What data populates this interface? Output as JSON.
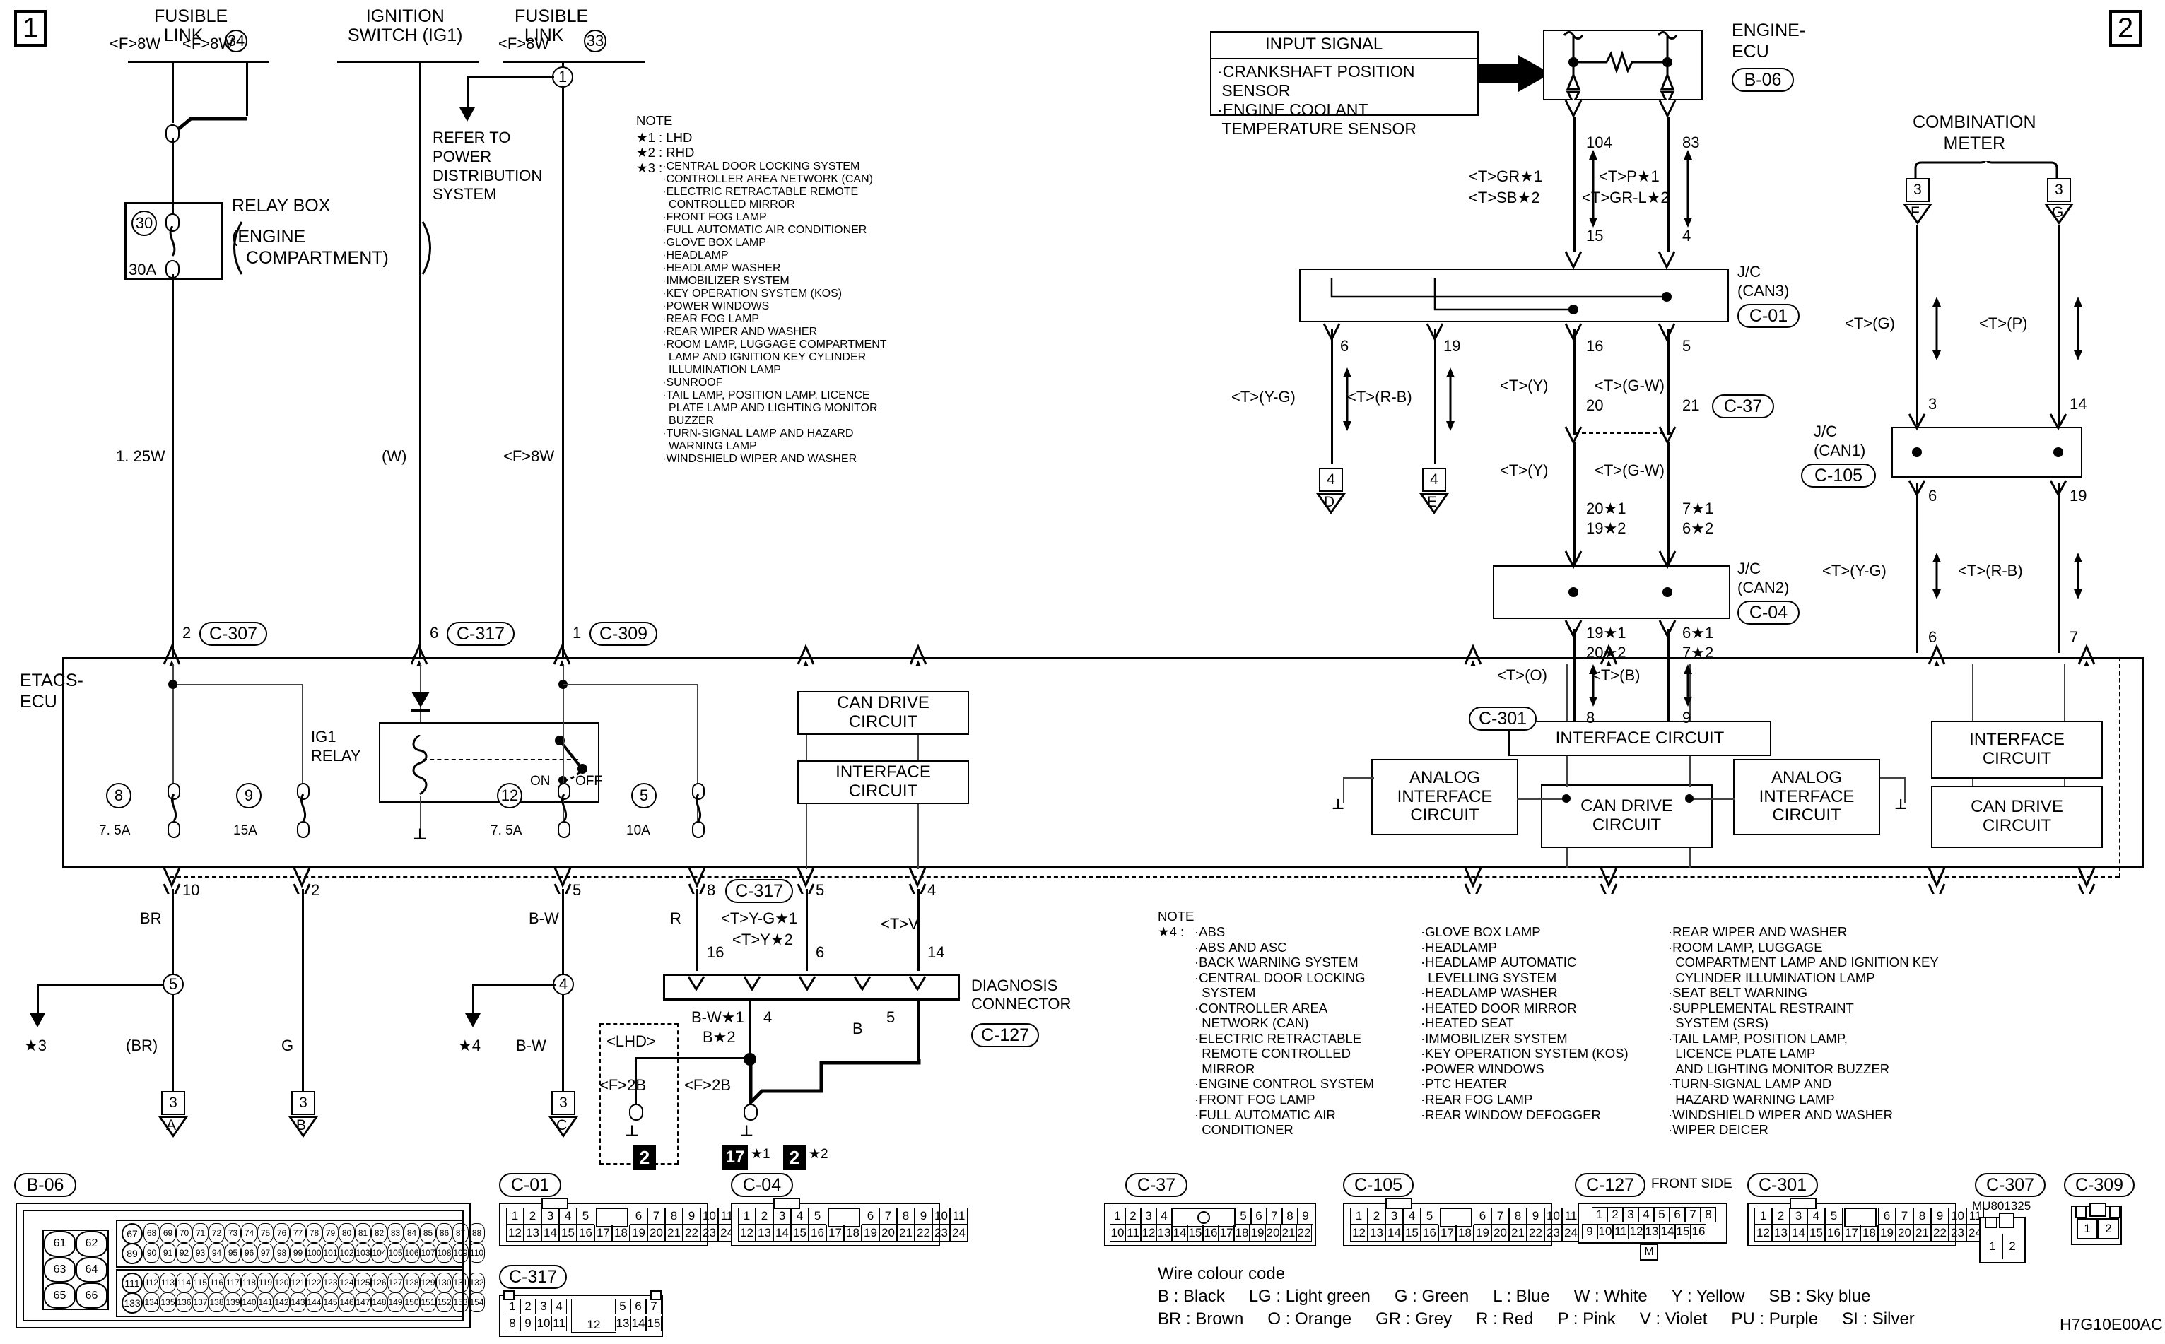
{
  "page": {
    "left_page_number": "1",
    "right_page_number": "2",
    "drawing_code": "H7G10E00AC"
  },
  "top_sources": [
    {
      "name": "FUSIBLE\nLINK",
      "circle": "34"
    },
    {
      "name": "IGNITION\nSWITCH (IG1)",
      "circle": ""
    },
    {
      "name": "FUSIBLE\nLINK",
      "circle": "33"
    }
  ],
  "top_wire_labels": [
    "<F>8W",
    "<F>8W",
    "<F>8W"
  ],
  "relay_box": {
    "label": "RELAY BOX",
    "sub": "(ENGINE\nCOMPARTMENT)",
    "fuse_circle": "30",
    "fuse_rating": "30A"
  },
  "refer_text": "REFER TO\nPOWER\nDISTRIBUTION\nSYSTEM",
  "ign_branch_circle": "1",
  "mid_wire_labels": [
    "1. 25W",
    "(W)",
    "<F>8W"
  ],
  "note1": {
    "title": "NOTE",
    "lines": [
      "★1 : LHD",
      "★2 : RHD"
    ],
    "star3_label": "★3 :",
    "star3_items": [
      "·CENTRAL DOOR LOCKING SYSTEM",
      "·CONTROLLER AREA NETWORK (CAN)",
      "·ELECTRIC RETRACTABLE REMOTE",
      "  CONTROLLED MIRROR",
      "·FRONT FOG LAMP",
      "·FULL AUTOMATIC AIR CONDITIONER",
      "·GLOVE BOX LAMP",
      "·HEADLAMP",
      "·HEADLAMP WASHER",
      "·IMMOBILIZER SYSTEM",
      "·KEY OPERATION SYSTEM (KOS)",
      "·POWER WINDOWS",
      "·REAR FOG LAMP",
      "·REAR WIPER AND WASHER",
      "·ROOM LAMP, LUGGAGE COMPARTMENT",
      "  LAMP AND IGNITION KEY CYLINDER",
      "  ILLUMINATION LAMP",
      "·SUNROOF",
      "·TAIL LAMP, POSITION LAMP, LICENCE",
      "  PLATE LAMP AND LIGHTING MONITOR",
      "  BUZZER",
      "·TURN-SIGNAL LAMP AND HAZARD",
      "  WARNING LAMP",
      "·WINDSHIELD WIPER AND WASHER"
    ]
  },
  "etacs": {
    "label": "ETACS-\nECU",
    "ig1_relay_label": "IG1\nRELAY",
    "relay_on": "ON",
    "relay_off": "OFF",
    "fuses": [
      {
        "circle": "8",
        "rating": "7. 5A"
      },
      {
        "circle": "9",
        "rating": "15A"
      },
      {
        "circle": "12",
        "rating": "7. 5A"
      },
      {
        "circle": "5",
        "rating": "10A"
      }
    ],
    "blocks_left": [
      "CAN DRIVE\nCIRCUIT",
      "INTERFACE\nCIRCUIT"
    ],
    "blocks_right": [
      "INTERFACE CIRCUIT",
      "ANALOG\nINTERFACE\nCIRCUIT",
      "CAN DRIVE\nCIRCUIT",
      "ANALOG\nINTERFACE\nCIRCUIT",
      "INTERFACE\nCIRCUIT",
      "CAN DRIVE\nCIRCUIT"
    ]
  },
  "top_connectors": [
    {
      "pin": "2",
      "id": "C-307"
    },
    {
      "pin": "6",
      "id": "C-317"
    },
    {
      "pin": "1",
      "id": "C-309"
    }
  ],
  "bottom_pins_left": [
    "10",
    "2",
    "5",
    "8",
    "5",
    "4"
  ],
  "bottom_wire_colors": [
    "BR",
    "",
    "B-W",
    "R",
    "",
    ""
  ],
  "lower_left": {
    "branch5": "5",
    "star3": "★3",
    "br_paren": "(BR)",
    "g_wire": "G",
    "branch4": "4",
    "star4": "★4",
    "bw_wire": "B-W",
    "grounds": [
      {
        "num": "3",
        "letter": "A"
      },
      {
        "num": "3",
        "letter": "B"
      },
      {
        "num": "3",
        "letter": "C"
      }
    ]
  },
  "diagnosis": {
    "title": "DIAGNOSIS\nCONNECTOR",
    "id": "C-127",
    "c317_pin": "8",
    "c317_id": "C-317",
    "wire_yg": "<T>Y-G★1",
    "wire_y": "<T>Y★2",
    "wire_v": "<T>V",
    "top_pins": [
      "5",
      "4"
    ],
    "conn_pins": [
      "16",
      "6",
      "14"
    ],
    "pin4": "4",
    "pin5": "5",
    "gnd_wire1": "B-W★1",
    "gnd_wire2": "B★2",
    "gnd_wire_b": "B",
    "lhd": "<LHD>",
    "f2b_left": "<F>2B",
    "f2b_right": "<F>2B",
    "gnd_boxes": [
      "2",
      "17",
      "2"
    ],
    "gnd_stars": [
      "",
      "★1",
      "★2"
    ]
  },
  "input_signal": {
    "title": "INPUT SIGNAL",
    "items": [
      "·CRANKSHAFT POSITION",
      " SENSOR",
      "·ENGINE COOLANT",
      " TEMPERATURE SENSOR"
    ]
  },
  "engine_ecu": {
    "label": "ENGINE-\nECU",
    "id": "B-06",
    "pins": [
      "104",
      "83"
    ],
    "wires": [
      "<T>GR★1",
      "<T>SB★2",
      "<T>P★1",
      "<T>GR-L★2"
    ],
    "lower_pins": [
      "15",
      "4"
    ]
  },
  "jc_can3": {
    "label": "J/C\n(CAN3)",
    "id": "C-01",
    "pins_out": [
      "6",
      "19",
      "16",
      "5"
    ]
  },
  "jc_can2": {
    "label": "J/C\n(CAN2)",
    "id": "C-04",
    "pins_in": [
      "20★1",
      "19★2",
      "7★1",
      "6★2"
    ],
    "pins_out": [
      "19★1",
      "20★2",
      "6★1",
      "7★2"
    ]
  },
  "jc_can1": {
    "label": "J/C\n(CAN1)",
    "id": "C-105",
    "pins_in": [
      "3",
      "14"
    ],
    "pins_out": [
      "6",
      "19"
    ]
  },
  "c37": {
    "id": "C-37",
    "pins": [
      "20",
      "21"
    ]
  },
  "c301": {
    "id": "C-301",
    "pins": [
      "8",
      "9",
      "6",
      "7"
    ]
  },
  "mid_wires_right": [
    {
      "text": "<T>(Y-G)"
    },
    {
      "text": "<T>(R-B)"
    },
    {
      "text": "<T>(Y)"
    },
    {
      "text": "<T>(G-W)"
    },
    {
      "text": "<T>(Y)"
    },
    {
      "text": "<T>(G-W)"
    },
    {
      "text": "<T>(O)"
    },
    {
      "text": "<T>(B)"
    },
    {
      "text": "<T>(G)"
    },
    {
      "text": "<T>(P)"
    },
    {
      "text": "<T>(Y-G)"
    },
    {
      "text": "<T>(R-B)"
    }
  ],
  "grounds_right": [
    {
      "num": "4",
      "letter": "D"
    },
    {
      "num": "4",
      "letter": "E"
    }
  ],
  "combination_meter": {
    "label": "COMBINATION\nMETER",
    "boxes": [
      {
        "num": "3",
        "letter": "F"
      },
      {
        "num": "3",
        "letter": "G"
      }
    ],
    "pins": [
      "3",
      "14",
      "6",
      "19",
      "6",
      "7"
    ]
  },
  "note4": {
    "title": "NOTE",
    "label": "★4 :",
    "col1": [
      "·ABS",
      "·ABS AND ASC",
      "·BACK WARNING SYSTEM",
      "·CENTRAL DOOR LOCKING",
      "  SYSTEM",
      "·CONTROLLER AREA",
      "  NETWORK (CAN)",
      "·ELECTRIC RETRACTABLE",
      "  REMOTE CONTROLLED",
      "  MIRROR",
      "·ENGINE CONTROL SYSTEM",
      "·FRONT FOG LAMP",
      "·FULL AUTOMATIC AIR",
      "  CONDITIONER"
    ],
    "col2": [
      "·GLOVE BOX LAMP",
      "·HEADLAMP",
      "·HEADLAMP AUTOMATIC",
      "  LEVELLING SYSTEM",
      "·HEADLAMP WASHER",
      "·HEATED DOOR MIRROR",
      "·HEATED SEAT",
      "·IMMOBILIZER SYSTEM",
      "·KEY OPERATION SYSTEM (KOS)",
      "·POWER WINDOWS",
      "·PTC HEATER",
      "·REAR FOG LAMP",
      "·REAR WINDOW DEFOGGER"
    ],
    "col3": [
      "·REAR WIPER AND WASHER",
      "·ROOM LAMP, LUGGAGE",
      "  COMPARTMENT LAMP AND IGNITION KEY",
      "  CYLINDER ILLUMINATION LAMP",
      "·SEAT BELT WARNING",
      "·SUPPLEMENTAL RESTRAINT",
      "  SYSTEM (SRS)",
      "·TAIL LAMP, POSITION LAMP,",
      "  LICENCE PLATE LAMP",
      "  AND LIGHTING MONITOR BUZZER",
      "·TURN-SIGNAL LAMP AND",
      "  HAZARD WARNING LAMP",
      "·WINDSHIELD WIPER AND WASHER",
      "·WIPER DEICER"
    ]
  },
  "wire_colour_code": {
    "title": "Wire colour code",
    "row1": [
      "B : Black",
      "LG : Light green",
      "G : Green",
      "L : Blue",
      "W : White",
      "Y : Yellow",
      "SB : Sky blue"
    ],
    "row2": [
      "BR : Brown",
      "O : Orange",
      "GR : Grey",
      "R : Red",
      "P : Pink",
      "V : Violet",
      "PU : Purple",
      "SI : Silver"
    ]
  },
  "connector_views": {
    "b06": {
      "id": "B-06",
      "left_col": [
        "61",
        "62",
        "63",
        "64",
        "65",
        "66"
      ],
      "row1_start": "67",
      "row1": [
        "68",
        "69",
        "70",
        "71",
        "72",
        "73",
        "74",
        "75",
        "76",
        "77",
        "78",
        "79",
        "80",
        "81",
        "82",
        "83",
        "84",
        "85",
        "86",
        "87",
        "88"
      ],
      "row2_start": "89",
      "row2": [
        "90",
        "91",
        "92",
        "93",
        "94",
        "95",
        "96",
        "97",
        "98",
        "99",
        "100",
        "101",
        "102",
        "103",
        "104",
        "105",
        "106",
        "107",
        "108",
        "109",
        "110"
      ],
      "row3_start": "111",
      "row3": [
        "112",
        "113",
        "114",
        "115",
        "116",
        "117",
        "118",
        "119",
        "120",
        "121",
        "122",
        "123",
        "124",
        "125",
        "126",
        "127",
        "128",
        "129",
        "130",
        "131",
        "132"
      ],
      "row4_start": "133",
      "row4": [
        "134",
        "135",
        "136",
        "137",
        "138",
        "139",
        "140",
        "141",
        "142",
        "143",
        "144",
        "145",
        "146",
        "147",
        "148",
        "149",
        "150",
        "151",
        "152",
        "153",
        "154"
      ]
    },
    "c01": {
      "id": "C-01",
      "top": [
        "1",
        "2",
        "3",
        "4",
        "5",
        "",
        "6",
        "7",
        "8",
        "9",
        "10",
        "11"
      ],
      "bottom": [
        "12",
        "13",
        "14",
        "15",
        "16",
        "17",
        "18",
        "19",
        "20",
        "21",
        "22",
        "23",
        "24"
      ]
    },
    "c04": {
      "id": "C-04",
      "top": [
        "1",
        "2",
        "3",
        "4",
        "5",
        "",
        "6",
        "7",
        "8",
        "9",
        "10",
        "11"
      ],
      "bottom": [
        "12",
        "13",
        "14",
        "15",
        "16",
        "17",
        "18",
        "19",
        "20",
        "21",
        "22",
        "23",
        "24"
      ]
    },
    "c317": {
      "id": "C-317",
      "top": [
        "1",
        "2",
        "3",
        "4"
      ],
      "mid": "12",
      "top2": [
        "5",
        "6",
        "7"
      ],
      "bottom": [
        "8",
        "9",
        "10",
        "11"
      ],
      "bottom2": [
        "13",
        "14",
        "15"
      ]
    },
    "c37": {
      "id": "C-37",
      "top": [
        "1",
        "2",
        "3",
        "4",
        "",
        "5",
        "6",
        "7",
        "8",
        "9"
      ],
      "bottom": [
        "10",
        "11",
        "12",
        "13",
        "14",
        "15",
        "16",
        "17",
        "18",
        "19",
        "20",
        "21",
        "22"
      ]
    },
    "c105": {
      "id": "C-105",
      "top": [
        "1",
        "2",
        "3",
        "4",
        "5",
        "",
        "6",
        "7",
        "8",
        "9",
        "10",
        "11"
      ],
      "bottom": [
        "12",
        "13",
        "14",
        "15",
        "16",
        "17",
        "18",
        "19",
        "20",
        "21",
        "22",
        "23",
        "24"
      ]
    },
    "c127": {
      "id": "C-127",
      "side_label": "FRONT SIDE",
      "marker": "M",
      "top": [
        "1",
        "2",
        "3",
        "4",
        "5",
        "6",
        "7",
        "8"
      ],
      "bottom": [
        "9",
        "10",
        "11",
        "12",
        "13",
        "14",
        "15",
        "16"
      ]
    },
    "c301": {
      "id": "C-301",
      "top": [
        "1",
        "2",
        "3",
        "4",
        "5",
        "",
        "6",
        "7",
        "8",
        "9",
        "10",
        "11"
      ],
      "bottom": [
        "12",
        "13",
        "14",
        "15",
        "16",
        "17",
        "18",
        "19",
        "20",
        "21",
        "22",
        "23",
        "24"
      ]
    },
    "c307": {
      "id": "C-307",
      "part": "MU801325",
      "pins": [
        "1",
        "2"
      ]
    },
    "c309": {
      "id": "C-309",
      "pins": [
        "1",
        "2"
      ]
    }
  }
}
